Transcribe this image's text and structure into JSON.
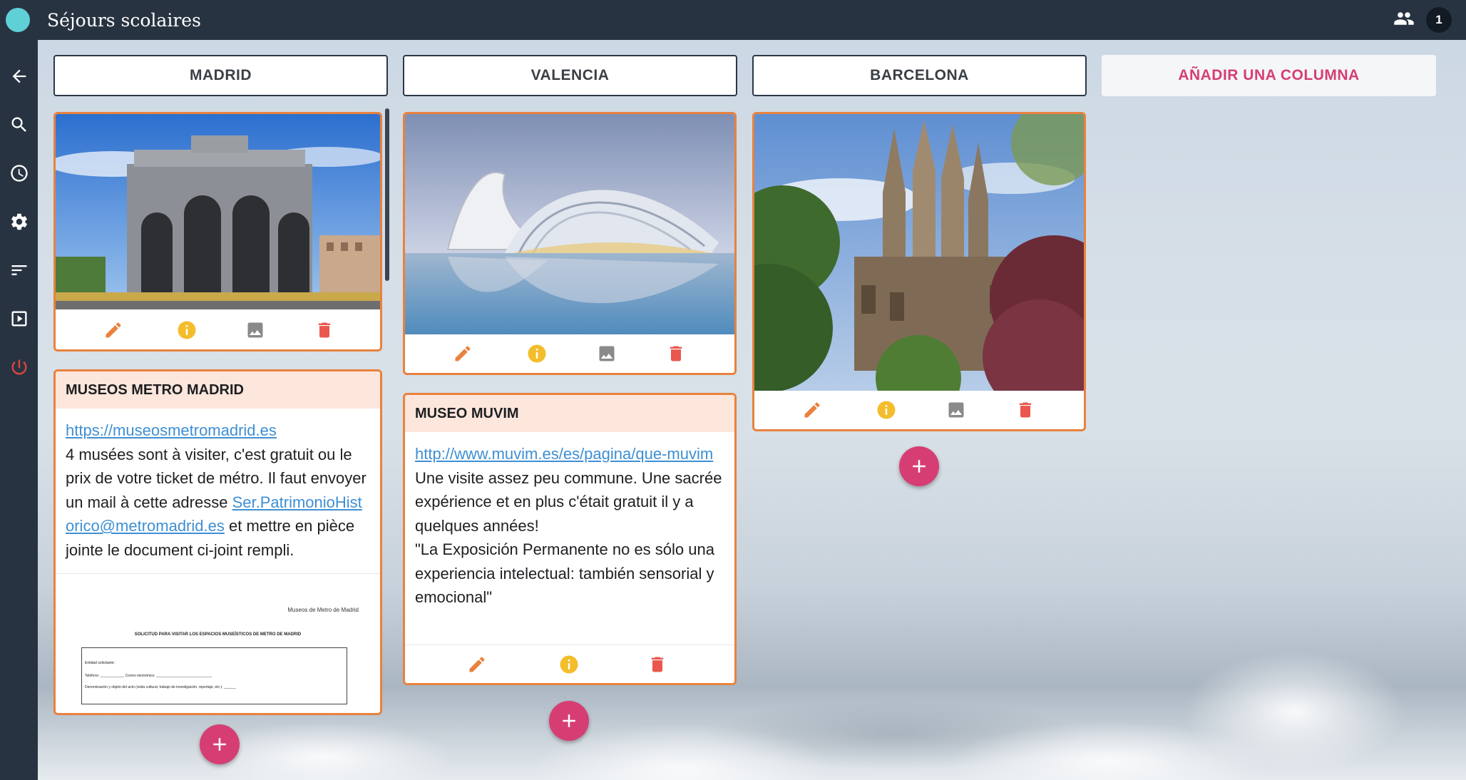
{
  "app": {
    "title": "Séjours scolaires",
    "user_count": "1"
  },
  "sidebar": {
    "items": [
      {
        "name": "back",
        "icon": "arrow-left-icon"
      },
      {
        "name": "search",
        "icon": "search-icon"
      },
      {
        "name": "history",
        "icon": "clock-icon"
      },
      {
        "name": "settings",
        "icon": "gear-icon"
      },
      {
        "name": "sort",
        "icon": "sort-icon"
      },
      {
        "name": "slideshow",
        "icon": "play-box-icon"
      },
      {
        "name": "logout",
        "icon": "power-icon"
      }
    ]
  },
  "columns": [
    {
      "header": "MADRID",
      "cards": [
        {
          "type": "image",
          "image_subject": "Puerta de Alcalá, Madrid"
        },
        {
          "type": "text",
          "title": "MUSEOS METRO MADRID",
          "link": "https://museosmetromadrid.es",
          "text_1": "4 musées sont à visiter, c'est gratuit ou le prix de votre ticket de métro. Il faut envoyer un mail à cette adresse",
          "email": "Ser.PatrimonioHistorico@metromadrid.es",
          "text_2": "et mettre en pièce jointe le document ci-joint rempli.",
          "doc": {
            "header": "Museos de Metro de Madrid",
            "title": "SOLICITUD PARA VISITAR LOS ESPACIOS MUSEÍSTICOS DE METRO DE MADRID",
            "line_1": "Entidad solicitante:",
            "line_2": "Teléfono: ____________ Correo electrónico: ____________________________",
            "line_3": "Denominación y objeto del acto (visita cultural, trabajo de investigación, reportaje, etc.): ______"
          }
        }
      ]
    },
    {
      "header": "VALENCIA",
      "cards": [
        {
          "type": "image",
          "image_subject": "Ciudad de las Artes y las Ciencias, Valencia"
        },
        {
          "type": "text",
          "title": "MUSEO MUVIM",
          "link": "http://www.muvim.es/es/pagina/que-muvim",
          "text_1": "Une visite assez peu commune. Une sacrée expérience et en plus c'était gratuit il y a quelques années!",
          "text_2": "\"La Exposición Permanente no es sólo una experiencia intelectual: también sensorial y emocional\""
        }
      ]
    },
    {
      "header": "BARCELONA",
      "cards": [
        {
          "type": "image",
          "image_subject": "Sagrada Família, Barcelona"
        }
      ]
    }
  ],
  "add_column_label": "AÑADIR UNA COLUMNA",
  "colors": {
    "accent": "#d63e73",
    "card_border": "#e8823e",
    "edit": "#e8823e",
    "info": "#f3bd2c",
    "image": "#8a8a8a",
    "delete": "#e9574e",
    "bar": "#283341"
  }
}
